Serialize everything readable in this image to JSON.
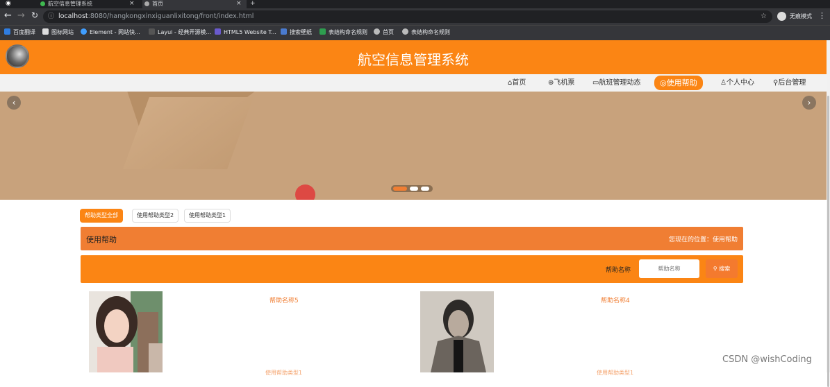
{
  "browser": {
    "tabs": [
      {
        "title": "航空信息管理系统",
        "active": false
      },
      {
        "title": "首页",
        "active": true
      }
    ],
    "url_host": "localhost",
    "url_rest": ":8080/hangkongxinxiguanlixitong/front/index.html",
    "profile_label": "无痕模式",
    "bookmarks": [
      "百度翻译",
      "图标网站",
      "Element - 网站快...",
      "Layui - 经典开源模...",
      "HTML5 Website T...",
      "搜索壁纸",
      "表结构命名规则",
      "首页",
      "表结构命名规则"
    ]
  },
  "site": {
    "title": "航空信息管理系统",
    "brand_color": "#fb8514"
  },
  "nav": {
    "items": [
      {
        "icon": "home-icon",
        "glyph": "⌂",
        "label": "首页"
      },
      {
        "icon": "ticket-icon",
        "glyph": "⊕",
        "label": "飞机票"
      },
      {
        "icon": "flight-icon",
        "glyph": "▭",
        "label": "航班管理动态"
      },
      {
        "icon": "help-icon",
        "glyph": "◎",
        "label": "使用帮助",
        "active": true
      },
      {
        "icon": "user-icon",
        "glyph": "♙",
        "label": "个人中心"
      },
      {
        "icon": "link-icon",
        "glyph": "⚲",
        "label": "后台管理"
      }
    ]
  },
  "categories": [
    "帮助类型全部",
    "使用帮助类型2",
    "使用帮助类型1"
  ],
  "breadcrumb": {
    "title": "使用帮助",
    "location": "您现在的位置：使用帮助"
  },
  "search": {
    "label": "帮助名称",
    "placeholder": "帮助名称",
    "button": "搜索"
  },
  "cards": [
    {
      "title": "帮助名称5",
      "subtitle": "使用帮助类型1"
    },
    {
      "title": "帮助名称4",
      "subtitle": "使用帮助类型1"
    }
  ],
  "watermark": "CSDN @wishCoding"
}
